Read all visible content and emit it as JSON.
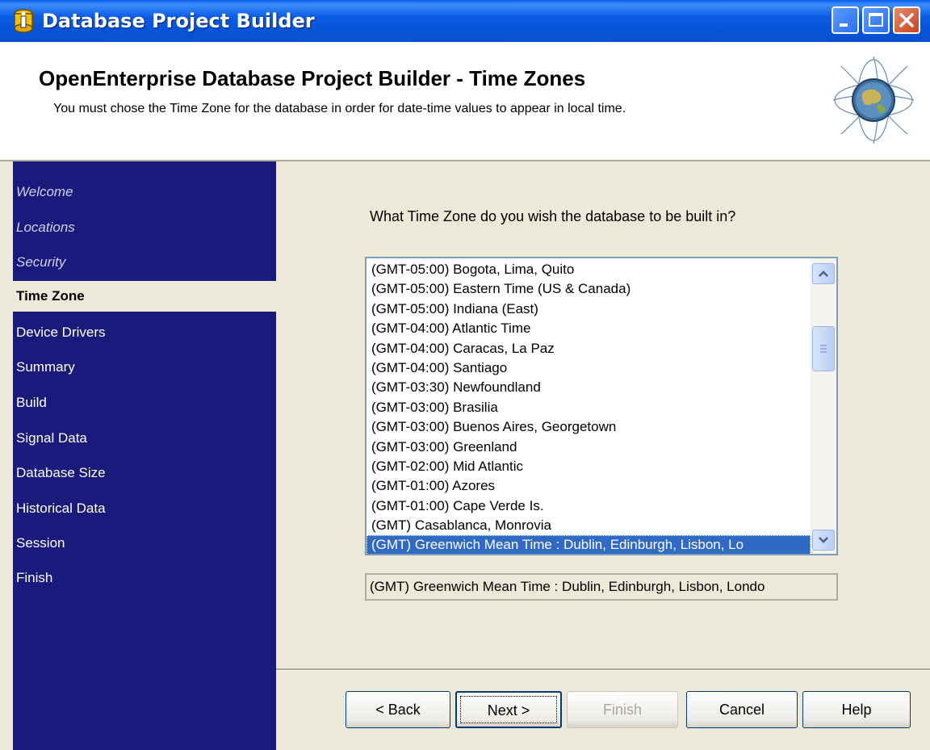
{
  "window": {
    "title": "Database Project Builder",
    "controls": [
      "minimize",
      "maximize",
      "close"
    ]
  },
  "header": {
    "title": "OpenEnterprise Database Project Builder - Time Zones",
    "subtitle": "You must chose the Time Zone for the database in order for date-time values to appear in local time."
  },
  "sidebar": {
    "items": [
      {
        "label": "Welcome",
        "state": "done"
      },
      {
        "label": "Locations",
        "state": "done"
      },
      {
        "label": "Security",
        "state": "done"
      },
      {
        "label": "Time Zone",
        "state": "active"
      },
      {
        "label": "Device Drivers",
        "state": "pending"
      },
      {
        "label": "Summary",
        "state": "pending"
      },
      {
        "label": "Build",
        "state": "pending"
      },
      {
        "label": "Signal Data",
        "state": "pending"
      },
      {
        "label": "Database Size",
        "state": "pending"
      },
      {
        "label": "Historical Data",
        "state": "pending"
      },
      {
        "label": "Session",
        "state": "pending"
      },
      {
        "label": "Finish",
        "state": "pending"
      }
    ]
  },
  "main": {
    "question": "What Time Zone do you wish the database to be built in?",
    "timezones": [
      "(GMT-05:00) Bogota, Lima, Quito",
      "(GMT-05:00) Eastern Time (US & Canada)",
      "(GMT-05:00) Indiana (East)",
      "(GMT-04:00) Atlantic Time",
      "(GMT-04:00) Caracas, La Paz",
      "(GMT-04:00) Santiago",
      "(GMT-03:30) Newfoundland",
      "(GMT-03:00) Brasilia",
      "(GMT-03:00) Buenos Aires, Georgetown",
      "(GMT-03:00) Greenland",
      "(GMT-02:00) Mid Atlantic",
      "(GMT-01:00) Azores",
      "(GMT-01:00) Cape Verde Is.",
      "(GMT) Casablanca, Monrovia",
      "(GMT) Greenwich Mean Time : Dublin, Edinburgh, Lisbon, Lo"
    ],
    "selected_index": 14,
    "selected_value": "(GMT) Greenwich Mean Time : Dublin, Edinburgh, Lisbon, Londo"
  },
  "buttons": {
    "back": "< Back",
    "next": "Next >",
    "finish": "Finish",
    "cancel": "Cancel",
    "help": "Help"
  },
  "colors": {
    "sidebar_bg": "#1a1a7c",
    "selection": "#316ac5",
    "titlebar": "#0654d8",
    "panel": "#ece9d8"
  }
}
